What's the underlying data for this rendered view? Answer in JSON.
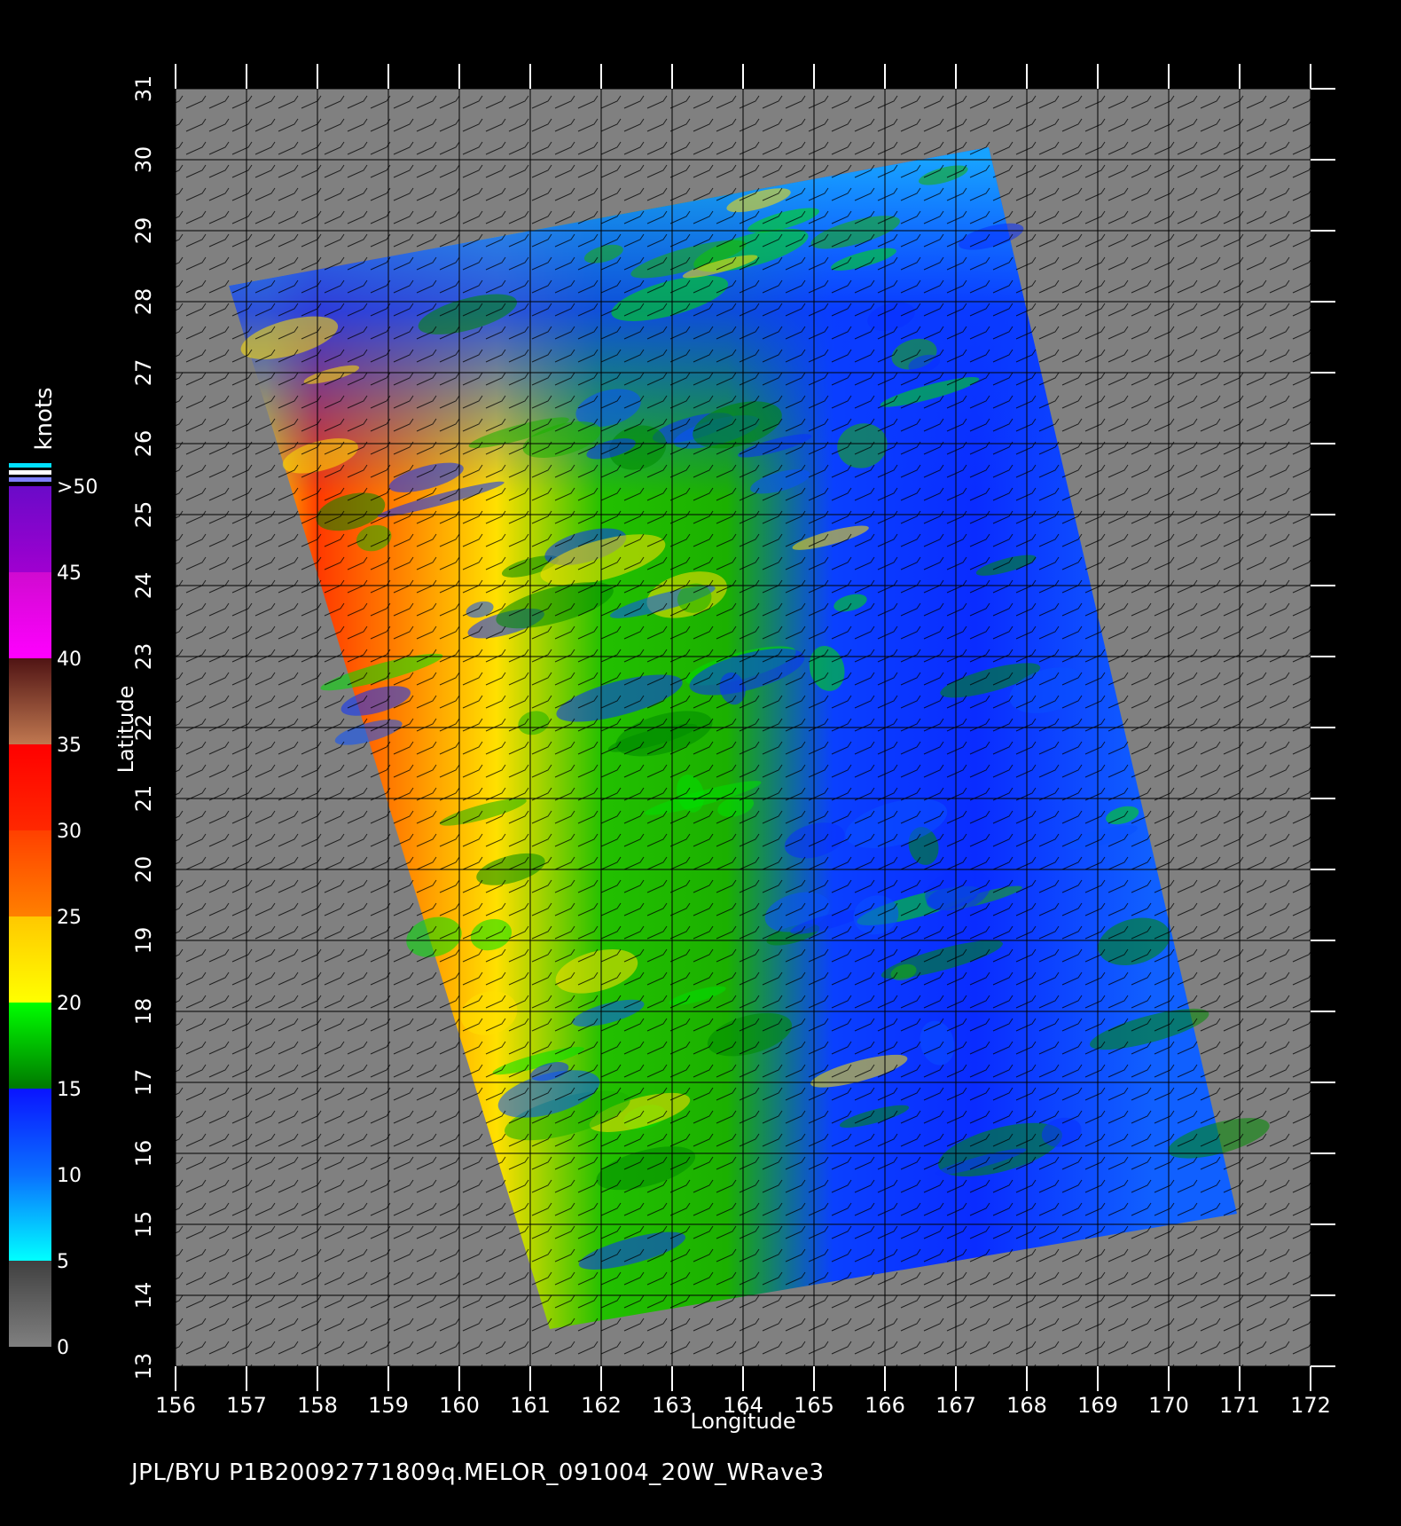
{
  "map": {
    "x_axis_label": "Longitude",
    "y_axis_label": "Latitude",
    "x_ticks": [
      "156",
      "157",
      "158",
      "159",
      "160",
      "161",
      "162",
      "163",
      "164",
      "165",
      "166",
      "167",
      "168",
      "169",
      "170",
      "171",
      "172"
    ],
    "y_ticks": [
      "13",
      "14",
      "15",
      "16",
      "17",
      "18",
      "19",
      "20",
      "21",
      "22",
      "23",
      "24",
      "25",
      "26",
      "27",
      "28",
      "29",
      "30",
      "31"
    ],
    "lon_range": [
      156,
      172
    ],
    "lat_range": [
      13,
      31
    ],
    "grid": true,
    "background_color": "#808080",
    "barb_color": "#000000"
  },
  "legend": {
    "unit_label": "knots",
    "labels": [
      ">50",
      "45",
      "40",
      "35",
      "30",
      "25",
      "20",
      "15",
      "10",
      "5",
      "0"
    ],
    "bands": [
      {
        "from": 0,
        "to": 5,
        "top": "#404040",
        "bottom": "#808080"
      },
      {
        "from": 5,
        "to": 10,
        "top": "#0a70ff",
        "bottom": "#00ffff"
      },
      {
        "from": 10,
        "to": 15,
        "top": "#0a14ff",
        "bottom": "#0a70ff"
      },
      {
        "from": 15,
        "to": 20,
        "top": "#00ff00",
        "bottom": "#007800"
      },
      {
        "from": 20,
        "to": 25,
        "top": "#ffc800",
        "bottom": "#ffff00"
      },
      {
        "from": 25,
        "to": 30,
        "top": "#ff4000",
        "bottom": "#ff8000"
      },
      {
        "from": 30,
        "to": 35,
        "top": "#ff0000",
        "bottom": "#ff2800"
      },
      {
        "from": 35,
        "to": 40,
        "top": "#501414",
        "bottom": "#c07850"
      },
      {
        "from": 40,
        "to": 45,
        "top": "#d00ad0",
        "bottom": "#ff00ff"
      },
      {
        "from": 45,
        "to": 50,
        "top": "#6a0ac8",
        "bottom": "#a000d0"
      }
    ],
    "cap_colors": [
      "#00e0ff",
      "#ffffff",
      "#8080ff"
    ]
  },
  "footer": {
    "text": "JPL/BYU  P1B20092771809q.MELOR_091004_20W_WRave3"
  }
}
